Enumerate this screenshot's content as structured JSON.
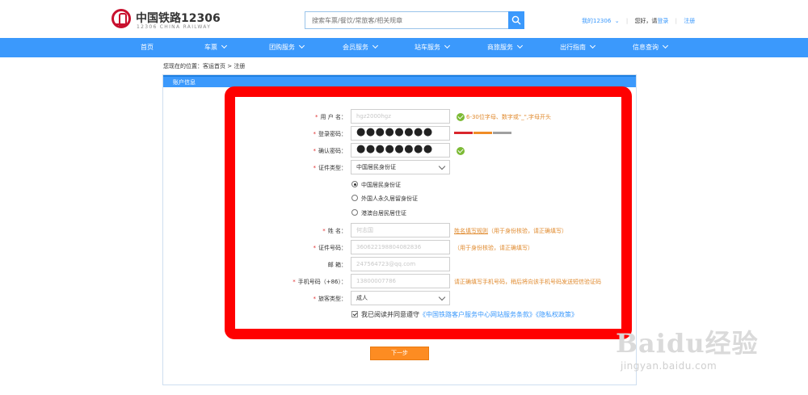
{
  "header": {
    "logo_cn": "中国铁路12306",
    "logo_en": "12306 CHINA RAILWAY",
    "search_placeholder": "搜索车票/餐饮/常旅客/相关规章",
    "my_12306": "我的12306",
    "greeting": "您好，请",
    "login": "登录",
    "register": "注册"
  },
  "nav": [
    "首页",
    "车票",
    "团购服务",
    "会员服务",
    "站车服务",
    "商旅服务",
    "出行指南",
    "信息查询"
  ],
  "breadcrumb": "您现在的位置：客运首页 > 注册",
  "panel_title": "账户信息",
  "form": {
    "username_label": "用 户 名：",
    "username_value": "hgz2000hgz",
    "username_hint": "6-30位字母、数字或\"_\",字母开头",
    "password_label": "登录密码：",
    "password_value": "●●●●●●●●",
    "confirm_label": "确认密码：",
    "confirm_value": "●●●●●●●●",
    "idtype_label": "证件类型：",
    "idtype_value": "中国居民身份证",
    "radio_1": "中国居民身份证",
    "radio_2": "外国人永久居留身份证",
    "radio_3": "港澳台居民居住证",
    "name_label": "姓 名：",
    "name_value": "何志国",
    "name_hint_link": "姓名填写规则",
    "name_hint": "（用于身份核验，请正确填写）",
    "idno_label": "证件号码：",
    "idno_value": "360622198804082836",
    "idno_hint": "（用于身份核验，请正确填写）",
    "email_label": "邮 箱：",
    "email_value": "247564723@qq.com",
    "phone_label": "手机号码（+86）：",
    "phone_value": "13800007786",
    "phone_hint": "请正确填写手机号码，稍后将向该手机号码发送短信验证码",
    "passenger_label": "旅客类型：",
    "passenger_value": "成人",
    "agree_text": "我已阅读并同意遵守",
    "agree_link1": "《中国铁路客户服务中心网站服务条款》",
    "agree_link2": "《隐私权政策》"
  },
  "next_button": "下一步",
  "watermark": {
    "main": "Baidu经验",
    "sub": "jingyan.baidu.com"
  },
  "colors": {
    "primary": "#3b99fc",
    "highlight": "#ff0000",
    "button": "#fd8c22",
    "hint": "#e08a2e"
  }
}
